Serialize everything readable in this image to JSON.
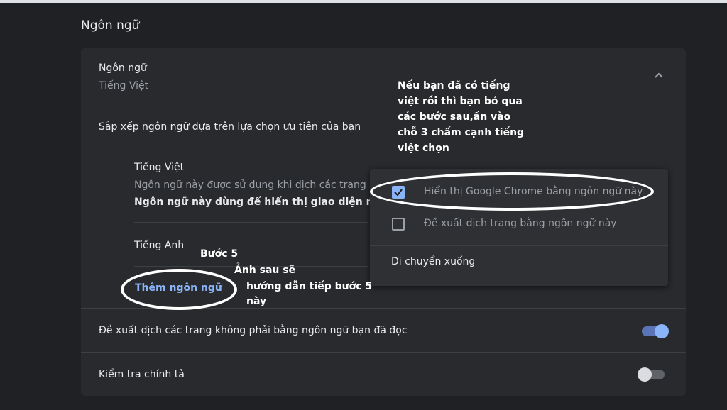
{
  "section": {
    "title": "Ngôn ngữ"
  },
  "card": {
    "header_label": "Ngôn ngữ",
    "header_value": "Tiếng Việt",
    "sort_description": "Sắp xếp ngôn ngữ dựa trên lựa chọn ưu tiên của bạn",
    "languages": [
      {
        "name": "Tiếng Việt",
        "note": "Ngôn ngữ này được sử dụng khi dịch các trang",
        "note_bold": "Ngôn ngữ này dùng để hiển thị giao diện người dùng"
      },
      {
        "name": "Tiếng Anh"
      }
    ],
    "add_language": "Thêm ngôn ngữ",
    "offer_translate": {
      "label": "Đề xuất dịch các trang không phải bằng ngôn ngữ bạn đã đọc",
      "enabled": true
    },
    "spell_check": {
      "label": "Kiểm tra chính tả",
      "enabled": false
    }
  },
  "context_menu": {
    "items": [
      {
        "label": "Hiển thị Google Chrome bằng ngôn ngữ này",
        "checked": true
      },
      {
        "label": "Đề xuất dịch trang bằng ngôn ngữ này",
        "checked": false
      },
      {
        "label": "Di chuyển xuống"
      }
    ]
  },
  "annotations": {
    "note_lines": [
      "Nếu bạn đã có tiếng",
      "việt rồi thì bạn bỏ qua",
      "các bước sau,ấn vào",
      "chỗ 3 chấm cạnh tiếng",
      "việt chọn"
    ],
    "step": "Bước 5",
    "next_lines": [
      "Ảnh sau sẽ",
      "hướng dẫn tiếp bước 5",
      "này"
    ]
  },
  "colors": {
    "accent": "#8ab4f8",
    "background": "#202124",
    "card": "#292a2d",
    "annotation": "#ffffff"
  }
}
